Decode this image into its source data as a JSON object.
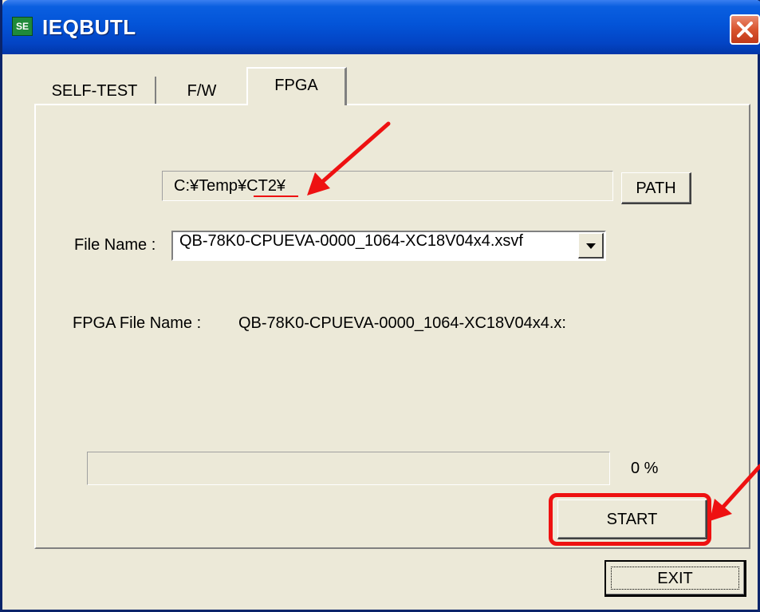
{
  "window": {
    "title": "IEQBUTL",
    "icon_text": "SE",
    "icon": "app-icon",
    "close_icon": "close-icon"
  },
  "tabs": [
    {
      "label": "SELF-TEST",
      "active": false
    },
    {
      "label": "F/W",
      "active": false
    },
    {
      "label": "FPGA",
      "active": true
    }
  ],
  "fpga_panel": {
    "path_value": "C:¥Temp¥CT2¥",
    "path_button_label": "PATH",
    "file_name_label": "File Name :",
    "file_name_selected": "QB-78K0-CPUEVA-0000_1064-XC18V04x4.xsvf",
    "fpga_file_name_label": "FPGA File Name :",
    "fpga_file_name_value": "QB-78K0-CPUEVA-0000_1064-XC18V04x4.x:",
    "progress_percent": 0,
    "progress_text": "0 %",
    "start_button_label": "START"
  },
  "exit_button_label": "EXIT",
  "colors": {
    "titlebar": "#0354d8",
    "dialog_bg": "#ece9d8",
    "annotation_red": "#ee1111"
  }
}
